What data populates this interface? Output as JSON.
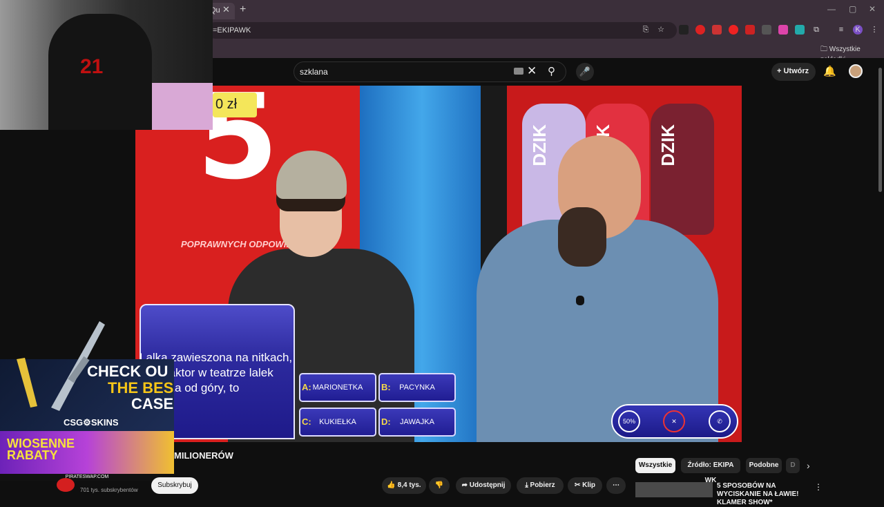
{
  "browser": {
    "tab_fragment": "Qu",
    "address_fragment": "=EKIPAWK",
    "bookmarks_label": "Wszystkie zakładki"
  },
  "youtube": {
    "search_value": "szklana",
    "create_label": "Utwórz"
  },
  "video": {
    "prize_label": "0 zł",
    "big_number": "5",
    "correct_text": "POPRAWNYCH ODPOWIE",
    "question": "Lalka zawieszona na nitkach, którą aktor w teatrze lalek porusza od góry, to",
    "answers": [
      {
        "letter": "A:",
        "text": "MARIONETKA"
      },
      {
        "letter": "B:",
        "text": "PACYNKA"
      },
      {
        "letter": "C:",
        "text": "KUKIEŁKA"
      },
      {
        "letter": "D:",
        "text": "JAWAJKA"
      }
    ],
    "lifelines": [
      "50%",
      "audience",
      "phone"
    ],
    "bottles": [
      "DZIK",
      "DZIK",
      "DZIK"
    ]
  },
  "webcam": {
    "print": "21"
  },
  "ads": {
    "ad1_line1": "CHECK OU",
    "ad1_line2": "THE BES",
    "ad1_line3": "CASE",
    "ad1_logo": "CSG⚙SKINS",
    "ad2_text": "WIOSENNE RABATY",
    "ad2_bar": "PIRATESWAP.COM"
  },
  "below": {
    "title": "MILIONERÓW",
    "subscribers": "701 tys. subskrybentów",
    "subscribe_label": "Subskrybuj",
    "like_count": "8,4 tys.",
    "share_label": "Udostępnij",
    "download_label": "Pobierz",
    "clip_label": "Klip"
  },
  "chips": [
    "Wszystkie",
    "Źródło: EKIPA WK",
    "Podobne"
  ],
  "recommendation": {
    "title": "5 SPOSOBÓW NA WYCISKANIE NA ŁAWIE! KLAMER SHOW*"
  },
  "colors": {
    "accent_red": "#d9201f",
    "question_blue": "#2d2a9e",
    "answer_gold": "#f4d84a"
  }
}
